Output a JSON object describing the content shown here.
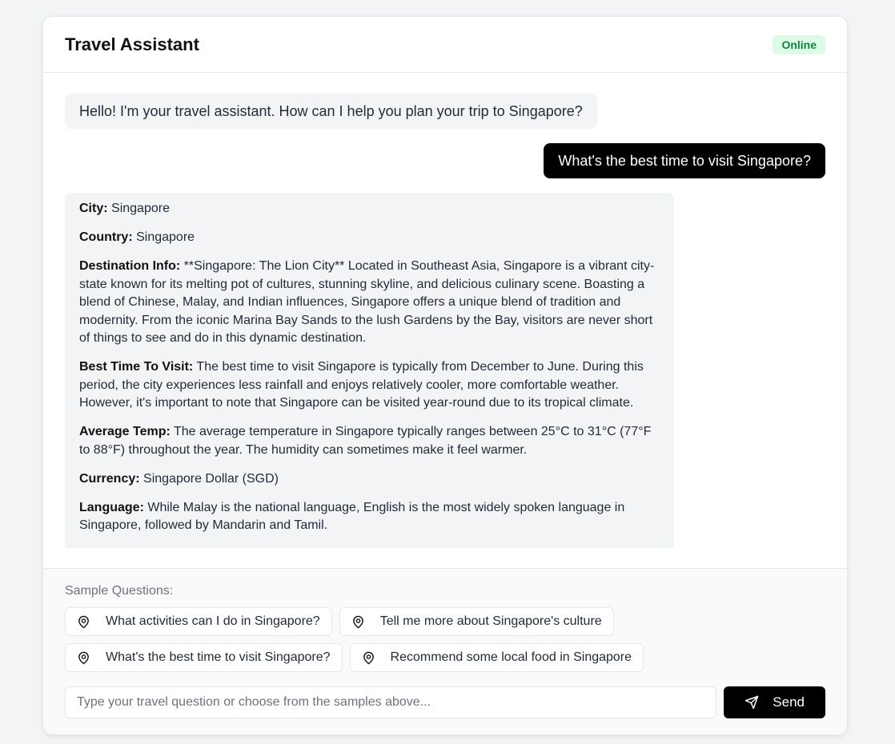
{
  "header": {
    "title": "Travel Assistant",
    "status": "Online"
  },
  "messages": [
    {
      "role": "assistant",
      "text": "Hello! I'm your travel assistant. How can I help you plan your trip to Singapore?"
    },
    {
      "role": "user",
      "text": "What's the best time to visit Singapore?"
    }
  ],
  "info": [
    {
      "label": "City:",
      "value": "Singapore"
    },
    {
      "label": "Country:",
      "value": "Singapore"
    },
    {
      "label": "Destination Info:",
      "value": "**Singapore: The Lion City** Located in Southeast Asia, Singapore is a vibrant city-state known for its melting pot of cultures, stunning skyline, and delicious culinary scene. Boasting a blend of Chinese, Malay, and Indian influences, Singapore offers a unique blend of tradition and modernity. From the iconic Marina Bay Sands to the lush Gardens by the Bay, visitors are never short of things to see and do in this dynamic destination."
    },
    {
      "label": "Best Time To Visit:",
      "value": "The best time to visit Singapore is typically from December to June. During this period, the city experiences less rainfall and enjoys relatively cooler, more comfortable weather. However, it's important to note that Singapore can be visited year-round due to its tropical climate."
    },
    {
      "label": "Average Temp:",
      "value": "The average temperature in Singapore typically ranges between 25°C to 31°C (77°F to 88°F) throughout the year. The humidity can sometimes make it feel warmer."
    },
    {
      "label": "Currency:",
      "value": "Singapore Dollar (SGD)"
    },
    {
      "label": "Language:",
      "value": "While Malay is the national language, English is the most widely spoken language in Singapore, followed by Mandarin and Tamil."
    }
  ],
  "samples": {
    "label": "Sample Questions:",
    "icon": "map-pin-icon",
    "items": [
      "What activities can I do in Singapore?",
      "Tell me more about Singapore's culture",
      "What's the best time to visit Singapore?",
      "Recommend some local food in Singapore"
    ]
  },
  "composer": {
    "placeholder": "Type your travel question or choose from the samples above...",
    "value": "",
    "send_label": "Send",
    "send_icon": "send-icon"
  },
  "colors": {
    "accent": "#000000",
    "online_bg": "#dcfce7",
    "online_text": "#15803d",
    "bubble_bg": "#f3f4f6"
  }
}
